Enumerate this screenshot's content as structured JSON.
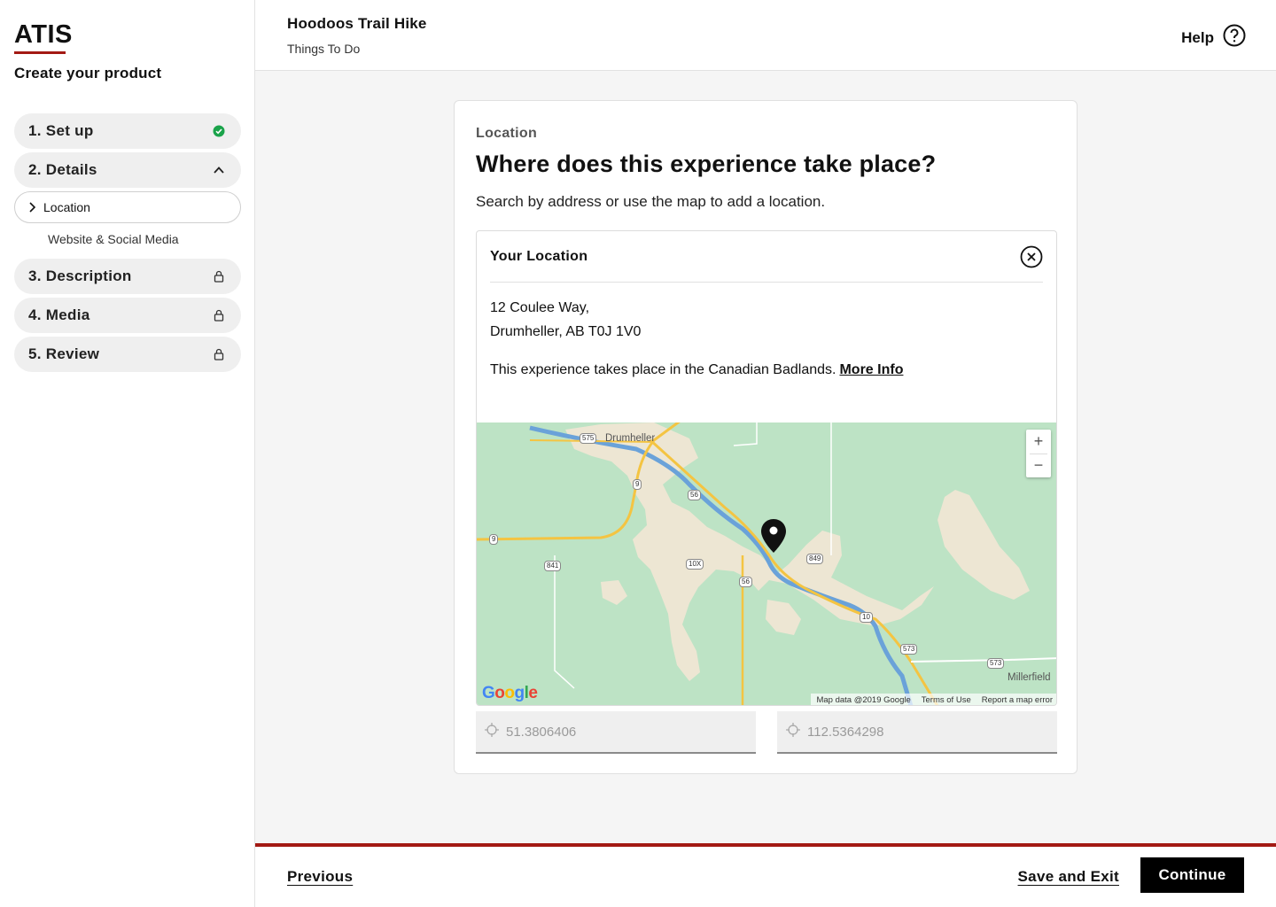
{
  "app": {
    "logo": "ATIS",
    "subtitle": "Create your product"
  },
  "colors": {
    "accent": "#a31a14",
    "success": "#1aa34a"
  },
  "steps": [
    {
      "label": "1. Set up",
      "icon": "check-circle-icon"
    },
    {
      "label": "2. Details",
      "icon": "chevron-up-icon"
    },
    {
      "label": "3. Description",
      "icon": "lock-icon"
    },
    {
      "label": "4. Media",
      "icon": "lock-icon"
    },
    {
      "label": "5. Review",
      "icon": "lock-icon"
    }
  ],
  "substeps": {
    "active": "Location",
    "next": "Website & Social Media"
  },
  "header": {
    "title": "Hoodoos Trail Hike",
    "category": "Things To Do",
    "help": "Help"
  },
  "card": {
    "section": "Location",
    "title": "Where does this experience take place?",
    "description": "Search by address or use the map to add a location."
  },
  "location": {
    "heading": "Your Location",
    "address_line1": "12 Coulee Way,",
    "address_line2": "Drumheller, AB T0J 1V0",
    "region_text": "This experience takes place in the Canadian Badlands.",
    "more_info": "More Info"
  },
  "map": {
    "towns": [
      "Drumheller",
      "Millerfield"
    ],
    "shields": [
      "575",
      "9",
      "56",
      "9",
      "841",
      "10X",
      "56",
      "849",
      "10",
      "573",
      "573"
    ],
    "zoom_in": "+",
    "zoom_out": "−",
    "google": "Google",
    "footer": [
      "Map data @2019 Google",
      "Terms of Use",
      "Report a map error"
    ]
  },
  "coords": {
    "latitude": "51.3806406",
    "longitude": "112.5364298"
  },
  "footer": {
    "previous": "Previous",
    "save_exit": "Save and Exit",
    "continue": "Continue"
  }
}
